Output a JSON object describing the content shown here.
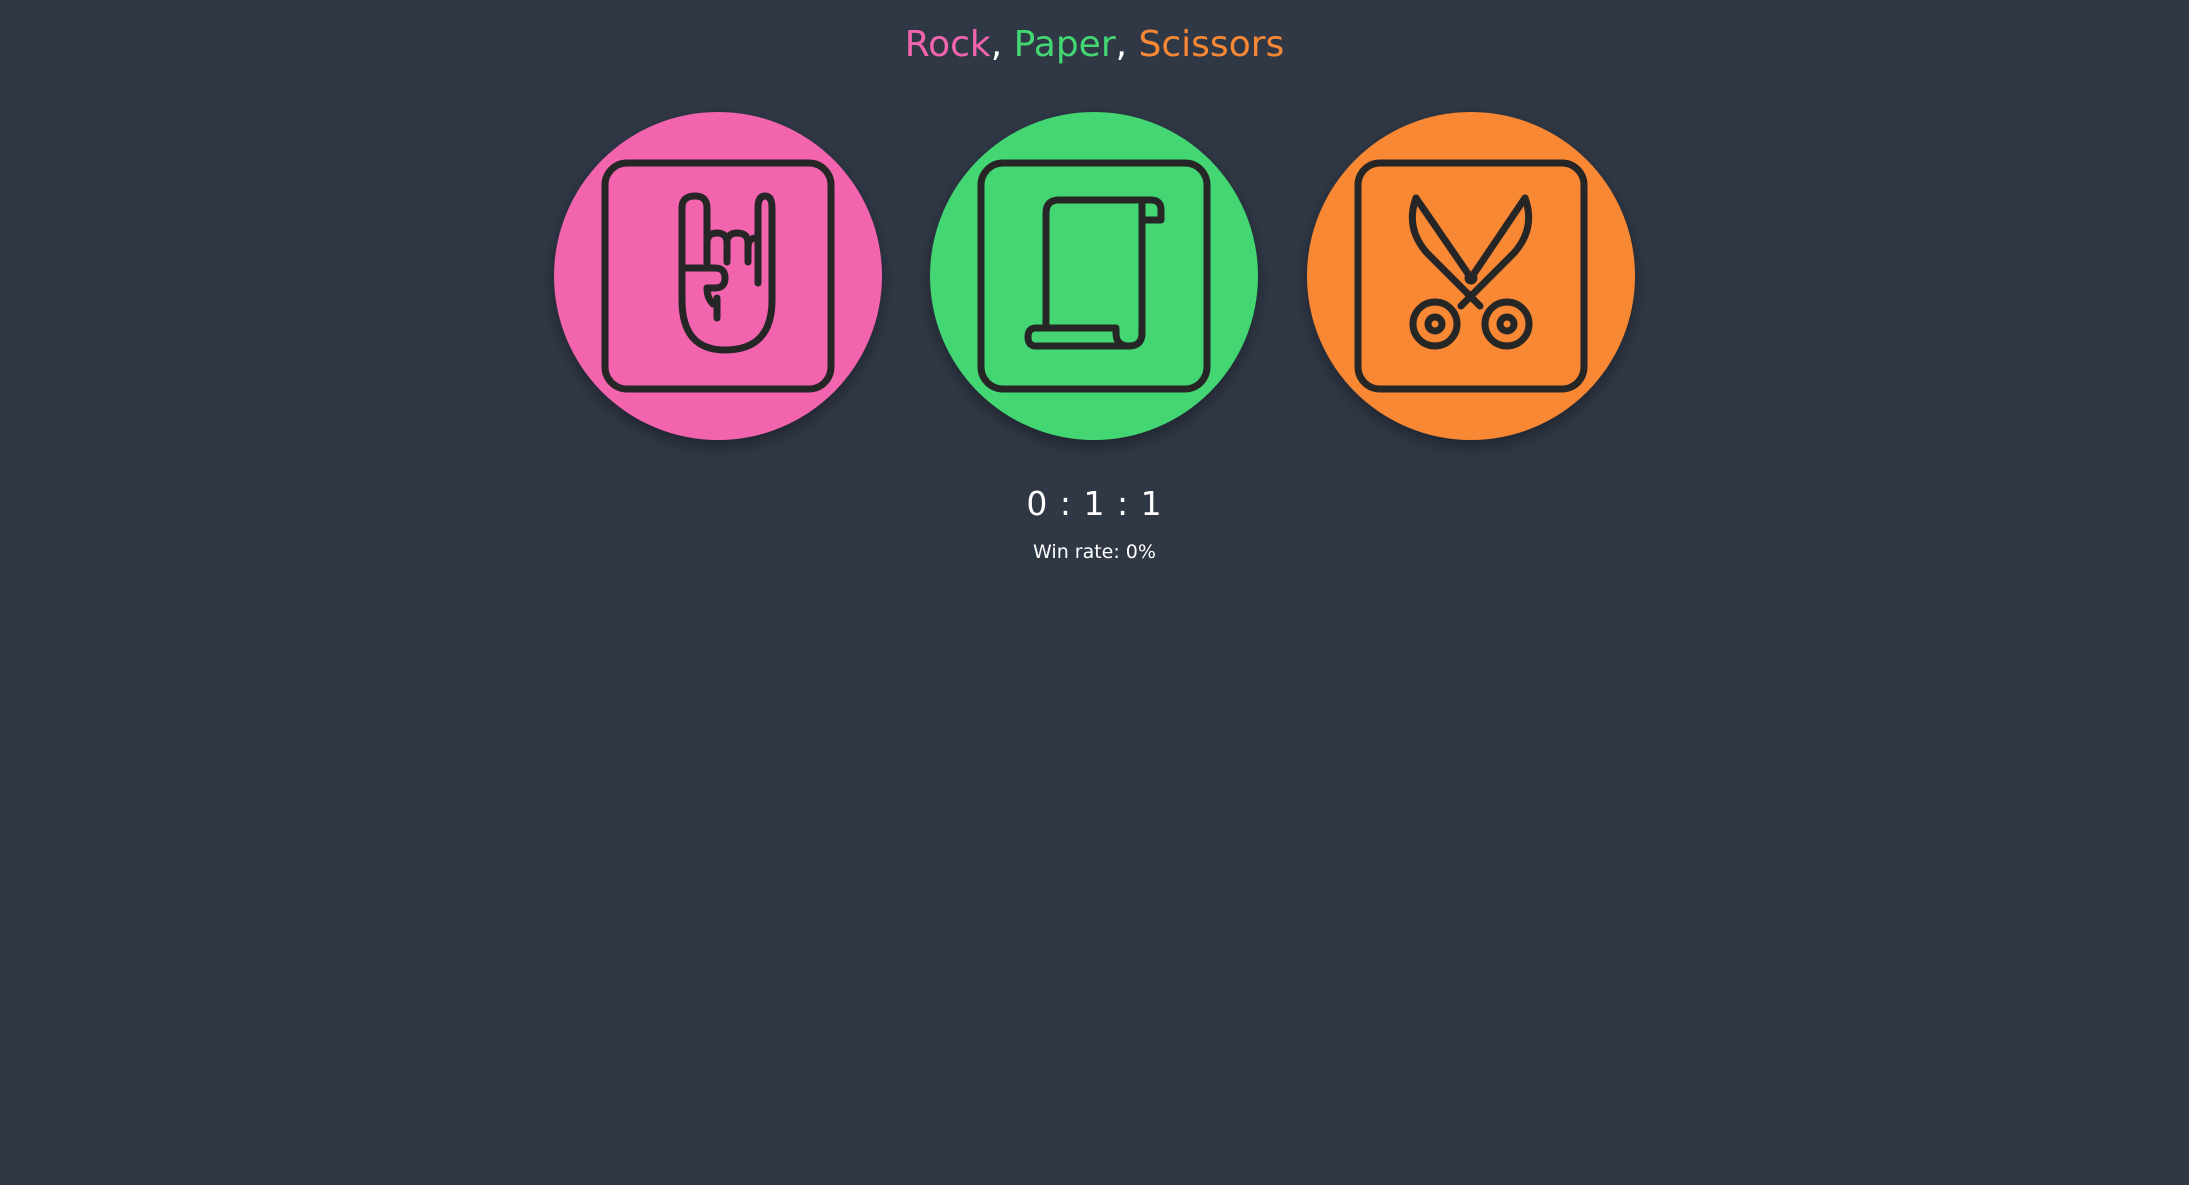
{
  "title": {
    "rock": "Rock",
    "sep1": ",",
    "paper": "Paper",
    "sep2": ",",
    "scissors": "Scissors"
  },
  "choices": [
    {
      "name": "rock",
      "icon": "rock-hand-icon",
      "color": "#f364af"
    },
    {
      "name": "paper",
      "icon": "paper-scroll-icon",
      "color": "#43d673"
    },
    {
      "name": "scissors",
      "icon": "scissors-icon",
      "color": "#f88834"
    }
  ],
  "score": {
    "text": "0 : 1 : 1"
  },
  "win_rate": {
    "text": "Win rate: 0%"
  },
  "colors": {
    "background": "#303846",
    "icon_stroke": "#262626"
  }
}
